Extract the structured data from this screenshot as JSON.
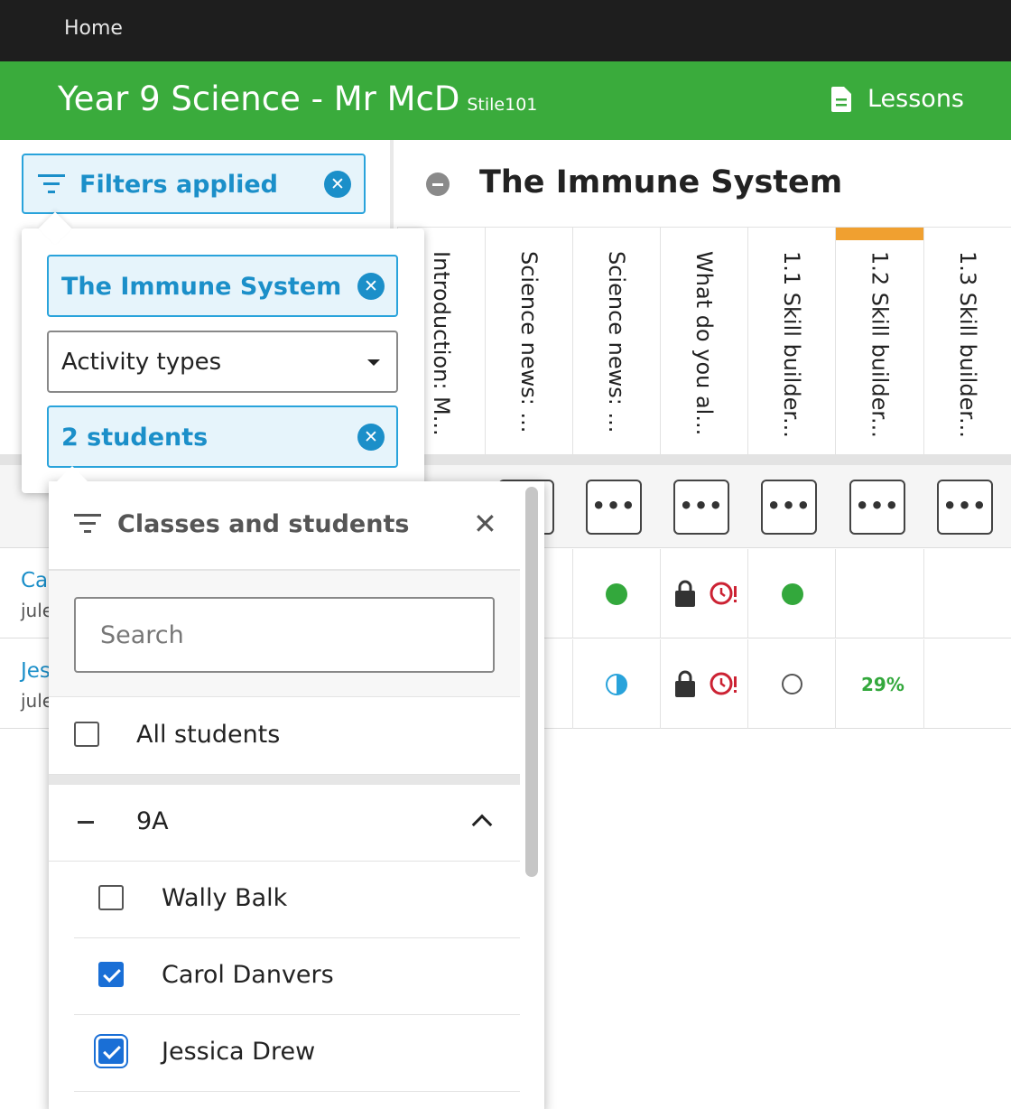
{
  "topbar": {
    "home": "Home"
  },
  "header": {
    "title": "Year 9 Science - Mr McD",
    "code": "Stile101",
    "lessons": "Lessons",
    "accent": "#3aab3c"
  },
  "filters": {
    "label": "Filters applied"
  },
  "dropdown": {
    "topic_chip": "The Immune System",
    "activity_select": "Activity types",
    "students_chip": "2 students"
  },
  "topic": {
    "name": "The Immune System"
  },
  "columns": [
    {
      "title": "Introduction: M..."
    },
    {
      "title": "Science news: ..."
    },
    {
      "title": "Science news: ..."
    },
    {
      "title": "What do you al..."
    },
    {
      "title": "1.1 Skill builder..."
    },
    {
      "title": "1.2 Skill builder..."
    },
    {
      "title": "1.3 Skill builder..."
    }
  ],
  "actions_label": "•••",
  "students": [
    {
      "name": "Ca",
      "username": "jule"
    },
    {
      "name": "Jes",
      "username": "jule",
      "score": "29%"
    }
  ],
  "panel": {
    "title": "Classes and students",
    "close": "✕",
    "search_placeholder": "Search",
    "all_students": "All students",
    "class_name": "9A",
    "members": [
      {
        "name": "Wally Balk",
        "checked": false
      },
      {
        "name": "Carol Danvers",
        "checked": true
      },
      {
        "name": "Jessica Drew",
        "checked": true
      }
    ]
  }
}
